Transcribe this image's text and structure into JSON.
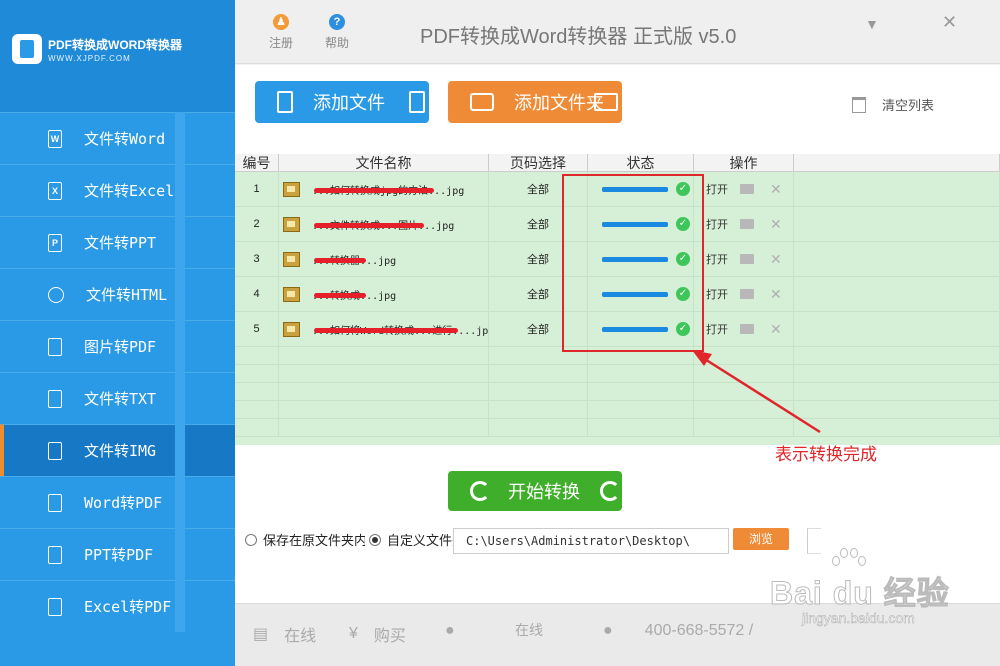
{
  "app": {
    "logo_title": "PDF转换成WORD转换器",
    "logo_subtitle": "WWW.XJPDF.COM",
    "title": "PDF转换成Word转换器 正式版 v5.0",
    "register_label": "注册",
    "help_label": "帮助",
    "minimize_glyph": "▼",
    "close_glyph": "✕"
  },
  "sidebar": {
    "items": [
      {
        "label": "文件转Word",
        "icon": "W"
      },
      {
        "label": "文件转Excel",
        "icon": "X"
      },
      {
        "label": "文件转PPT",
        "icon": "P"
      },
      {
        "label": "文件转HTML",
        "icon": "globe"
      },
      {
        "label": "图片转PDF",
        "icon": "pdf"
      },
      {
        "label": "文件转TXT",
        "icon": "TXT"
      },
      {
        "label": "文件转IMG",
        "icon": "img",
        "active": true
      },
      {
        "label": "Word转PDF",
        "icon": "pdf"
      },
      {
        "label": "PPT转PDF",
        "icon": "pdf"
      },
      {
        "label": "Excel转PDF",
        "icon": "pdf"
      }
    ]
  },
  "toolbar": {
    "add_file": "添加文件",
    "add_folder": "添加文件夹",
    "clear_list": "清空列表"
  },
  "table": {
    "headers": [
      "编号",
      "文件名称",
      "页码选择",
      "状态",
      "操作"
    ],
    "rows": [
      {
        "no": "1",
        "name": "...如何转换成jpg的方法...jpg",
        "pages": "全部",
        "progress": 1.0,
        "open": "打开",
        "delete": "✕"
      },
      {
        "no": "2",
        "name": "...文件转换成...图片...jpg",
        "pages": "全部",
        "progress": 1.0,
        "open": "打开",
        "delete": "✕"
      },
      {
        "no": "3",
        "name": "...转换器...jpg",
        "pages": "全部",
        "progress": 1.0,
        "open": "打开",
        "delete": "✕"
      },
      {
        "no": "4",
        "name": "...转换成...jpg",
        "pages": "全部",
        "progress": 1.0,
        "open": "打开",
        "delete": "✕"
      },
      {
        "no": "5",
        "name": "...如何将Word转换成...进行....jpg",
        "pages": "全部",
        "progress": 1.0,
        "open": "打开",
        "delete": "✕"
      }
    ],
    "check_glyph": "✓"
  },
  "annotation": {
    "text": "表示转换完成",
    "color": "#e0262a"
  },
  "actions": {
    "start": "开始转换",
    "save_original": "保存在原文件夹内",
    "save_custom": "自定义文件夹",
    "path": "C:\\Users\\Administrator\\Desktop\\",
    "browse": "浏览"
  },
  "footer": {
    "online_service": "在线",
    "buy": "购买",
    "online": "在线",
    "phone": "400-668-5572 /",
    "doc_glyph": "▤",
    "yen_glyph": "¥",
    "chat_glyph": "●",
    "phone_glyph": "●"
  },
  "watermark": {
    "logo": "Bai du 经验",
    "url": "jingyan.baidu.com"
  },
  "colors": {
    "sidebar": "#2b9ae6",
    "accent_orange": "#ef8b36",
    "start_green": "#3fae2a",
    "table_bg": "#d6efd7",
    "done_green": "#3fc65a"
  }
}
